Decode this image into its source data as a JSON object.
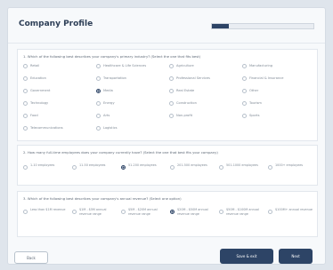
{
  "header": {
    "title": "Company Profile",
    "progress_fraction": 0.17
  },
  "q1": {
    "text": "1. Which of the following best describes your company's primary industry? (Select the one that fits best)",
    "options": [
      [
        "Retail",
        "Healthcare & Life Sciences",
        "Agriculture",
        "Manufacturing"
      ],
      [
        "Education",
        "Transportation",
        "Professional Services",
        "Financial & Insurance"
      ],
      [
        "Government",
        "Media",
        "Real Estate",
        "Other"
      ],
      [
        "Technology",
        "Energy",
        "Construction",
        "Tourism"
      ],
      [
        "Food",
        "Arts",
        "Non-profit",
        "Sports"
      ],
      [
        "Telecommunications",
        "Logistics",
        "",
        ""
      ]
    ],
    "selected_index": 9
  },
  "q2": {
    "text": "2. How many full-time employees does your company currently have? (Select the one that best fits your company)",
    "options": [
      "1-10 employees",
      "11-50 employees",
      "51-200 employees",
      "201-500 employees",
      "501-1000 employees",
      "1000+ employees"
    ],
    "selected_index": 2
  },
  "q3": {
    "text": "3. Which of the following best describes your company's annual revenue? (Select one option)",
    "options": [
      "Less than $1M revenue",
      "$1M - $5M annual revenue range",
      "$5M - $20M annual revenue range",
      "$20M - $50M annual revenue range",
      "$50M - $100M annual revenue range",
      "$100M+ annual revenue"
    ],
    "selected_index": 3
  },
  "footer": {
    "back_label": "Back",
    "save_label": "Save & exit",
    "next_label": "Next"
  },
  "colors": {
    "accent": "#2d4466"
  }
}
